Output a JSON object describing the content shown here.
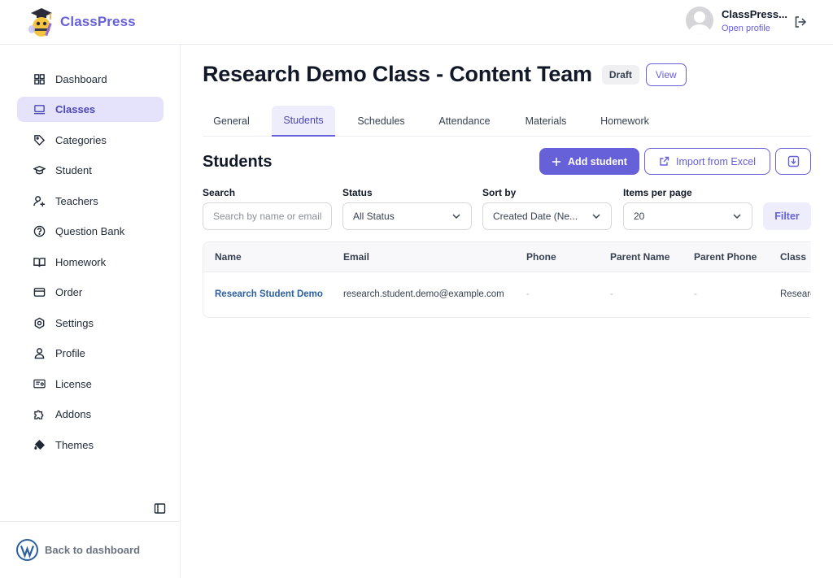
{
  "app": {
    "name": "ClassPress",
    "accent": "#6660d9"
  },
  "user": {
    "name": "ClassPress...",
    "link": "Open profile"
  },
  "sidebar": {
    "items": [
      {
        "label": "Dashboard",
        "icon": "dashboard-icon"
      },
      {
        "label": "Classes",
        "icon": "laptop-icon",
        "active": true
      },
      {
        "label": "Categories",
        "icon": "tag-icon"
      },
      {
        "label": "Student",
        "icon": "graduation-cap-icon"
      },
      {
        "label": "Teachers",
        "icon": "teacher-icon"
      },
      {
        "label": "Question Bank",
        "icon": "question-circle-icon"
      },
      {
        "label": "Homework",
        "icon": "book-open-icon"
      },
      {
        "label": "Order",
        "icon": "credit-card-icon"
      },
      {
        "label": "Settings",
        "icon": "gear-icon"
      },
      {
        "label": "Profile",
        "icon": "user-icon"
      },
      {
        "label": "License",
        "icon": "certificate-icon"
      },
      {
        "label": "Addons",
        "icon": "puzzle-icon"
      },
      {
        "label": "Themes",
        "icon": "paint-bucket-icon"
      }
    ],
    "back_label": "Back to dashboard"
  },
  "page": {
    "title": "Research Demo Class - Content Team",
    "status": "Draft",
    "view_label": "View"
  },
  "tabs": [
    "General",
    "Students",
    "Schedules",
    "Attendance",
    "Materials",
    "Homework"
  ],
  "students": {
    "title": "Students",
    "add_label": "Add student",
    "import_label": "Import from Excel"
  },
  "filters": {
    "search_label": "Search",
    "search_placeholder": "Search by name or email",
    "status_label": "Status",
    "status_value": "All Status",
    "sort_label": "Sort by",
    "sort_value": "Created Date (Ne...",
    "per_page_label": "Items per page",
    "per_page_value": "20",
    "filter_label": "Filter"
  },
  "table": {
    "columns": [
      "Name",
      "Email",
      "Phone",
      "Parent Name",
      "Parent Phone",
      "Class"
    ],
    "rows": [
      {
        "name": "Research Student Demo",
        "email": "research.student.demo@example.com",
        "phone": "-",
        "parent_name": "-",
        "parent_phone": "-",
        "class": "Researc"
      }
    ]
  }
}
